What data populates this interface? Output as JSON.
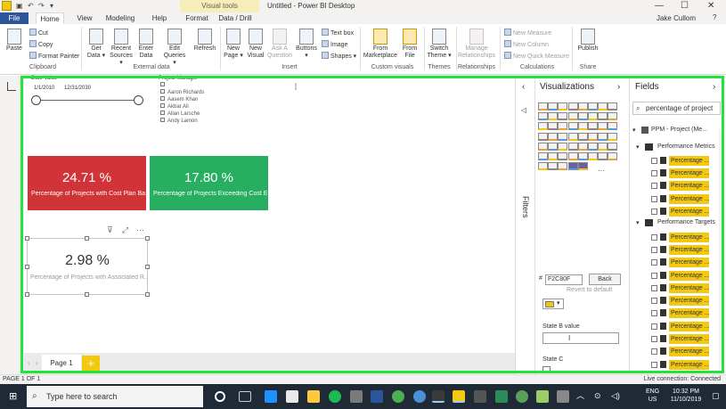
{
  "window": {
    "title": "Untitled - Power BI Desktop",
    "context_band": "Visual tools",
    "user": "Jake Cullom",
    "controls": {
      "minimize": "—",
      "maximize": "☐",
      "close": "✕"
    },
    "help": "?"
  },
  "tabs": [
    "File",
    "Home",
    "View",
    "Modeling",
    "Help",
    "Format",
    "Data / Drill"
  ],
  "ribbon": {
    "clipboard": {
      "paste": "Paste",
      "cut": "Cut",
      "copy": "Copy",
      "format_painter": "Format Painter",
      "group": "Clipboard"
    },
    "external": {
      "get_data": "Get Data ▾",
      "recent": "Recent Sources ▾",
      "enter": "Enter Data",
      "edit": "Edit Queries ▾",
      "refresh": "Refresh",
      "group": "External data"
    },
    "insert": {
      "new_page": "New Page ▾",
      "new_visual": "New Visual",
      "ask": "Ask A Question",
      "buttons": "Buttons ▾",
      "text_box": "Text box",
      "image": "Image",
      "shapes": "Shapes ▾",
      "group": "Insert"
    },
    "custom": {
      "marketplace": "From Marketplace",
      "file": "From File",
      "group": "Custom visuals"
    },
    "themes": {
      "switch": "Switch Theme ▾",
      "group": "Themes"
    },
    "relationships": {
      "manage": "Manage Relationships",
      "group": "Relationships"
    },
    "calculations": {
      "measure": "New Measure",
      "column": "New Column",
      "quick": "New Quick Measure",
      "group": "Calculations"
    },
    "share": {
      "publish": "Publish",
      "group": "Share"
    }
  },
  "canvas": {
    "date_slicer": {
      "title": "Date Value",
      "start": "1/1/2010",
      "end": "12/31/2030"
    },
    "project_manager": {
      "title": "Project Manager",
      "items": [
        "",
        "Aaron Richards",
        "Aasem Khan",
        "Akbar Ali",
        "Allan Larsche",
        "Andy Lamon"
      ]
    },
    "cards": [
      {
        "value": "24.71 %",
        "label": "Percentage of Projects with Cost Plan Ba...",
        "color": "#d13438"
      },
      {
        "value": "17.80 %",
        "label": "Percentage of Projects Exceeding Cost E...",
        "color": "#27ae60"
      },
      {
        "value": "2.98 %",
        "label": "Percentage of Projects with Associated R..."
      }
    ],
    "visual_header_icons": [
      "filter-icon",
      "focus-icon",
      "more-icon"
    ],
    "visual_header_glyphs": {
      "filter": "⊽",
      "focus": "⤢",
      "more": "···"
    },
    "page_tab": "Page 1",
    "add_page": "+",
    "page_scroll": {
      "left": "‹",
      "right": "›"
    }
  },
  "filters_pane": {
    "label": "Filters",
    "collapse": "◁"
  },
  "viz_pane": {
    "title": "Visualizations",
    "hex": "F2C80F",
    "hex_prefix": "#",
    "back": "Back",
    "revert": "Revert to default",
    "state_b": "State B value",
    "state_c": "State C",
    "nav": {
      "left": "‹",
      "right": "›"
    },
    "more_visuals": "···",
    "swatch_dropdown": "▾",
    "swatch_color": "#f2c80f"
  },
  "fields_pane": {
    "title": "Fields",
    "nav": "›",
    "search_value": "percentage of project",
    "search_icon": "⌕",
    "model": "PPM - Project (Me...",
    "table1": "Performance Metrics",
    "table2": "Performance Targets",
    "field_label": "Percentage ...",
    "expand": "▾",
    "collapse": "▸"
  },
  "status": {
    "left": "PAGE 1 OF 1",
    "right": "Live connection: Connected"
  },
  "taskbar": {
    "start": "⊞",
    "search_icon": "⌕",
    "search": "Type here to search",
    "lang": "ENG",
    "region": "US",
    "time": "10:32 PM",
    "date": "11/10/2019",
    "tray_glyphs": {
      "chevron": "︿",
      "network": "⊙",
      "volume": "◁)",
      "notification": "▢"
    }
  }
}
